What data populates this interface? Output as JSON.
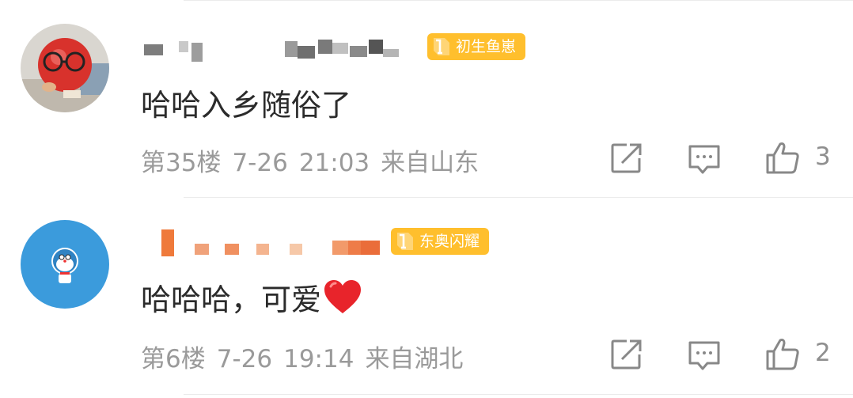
{
  "comments": [
    {
      "badge": "初生鱼崽",
      "content": "哈哈入乡随俗了",
      "floor": "第35楼",
      "date": "7-26",
      "time": "21:03",
      "location": "来自山东",
      "likes": "3"
    },
    {
      "badge": "东奥闪耀",
      "content": "哈哈哈，可爱",
      "floor": "第6楼",
      "date": "7-26",
      "time": "19:14",
      "location": "来自湖北",
      "likes": "2"
    }
  ],
  "icons": {
    "share": "share-icon",
    "comment": "comment-icon",
    "like": "thumbs-up-icon",
    "heart": "heart-emoji-icon"
  },
  "colors": {
    "badge": "#ffbf2d",
    "meta_text": "#9a9a9a",
    "content_text": "#2b2b2b",
    "heart": "#e8242b",
    "avatar2_bg": "#3b9bdc"
  }
}
